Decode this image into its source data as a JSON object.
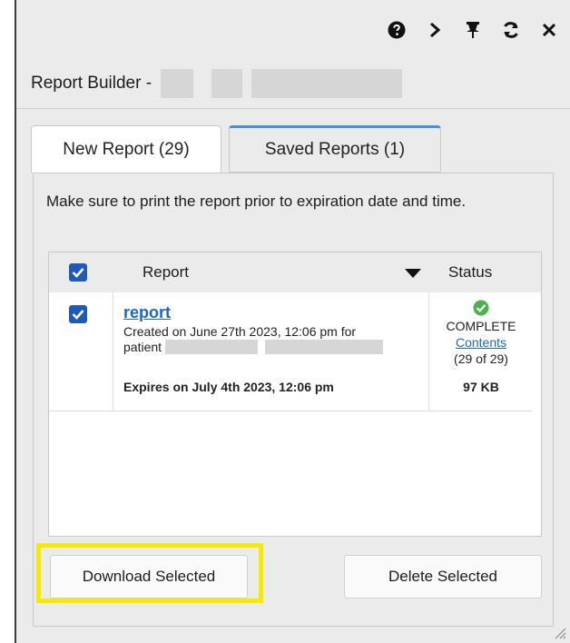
{
  "header": {
    "title": "Report Builder -",
    "icons": [
      "help-icon",
      "collapse-icon",
      "pin-icon",
      "refresh-icon",
      "close-icon"
    ]
  },
  "tabs": [
    {
      "label": "New Report (29)"
    },
    {
      "label": "Saved Reports (1)"
    }
  ],
  "notice": "Make sure to print the report prior to expiration date and time.",
  "table": {
    "columns": {
      "report": "Report",
      "status": "Status"
    },
    "rows": [
      {
        "name": "report",
        "created": "Created on June 27th 2023, 12:06 pm for",
        "patient_label": "patient",
        "expires": "Expires on July 4th 2023, 12:06 pm",
        "status": "COMPLETE",
        "contents_link": "Contents",
        "count": "(29 of 29)",
        "size": "97 KB"
      }
    ]
  },
  "buttons": {
    "download": "Download Selected",
    "delete": "Delete Selected"
  },
  "colors": {
    "accent": "#1e5ab6",
    "link": "#1a66c9",
    "highlight": "#f5ea05",
    "tab_active_border": "#4a90d9",
    "complete": "#4caf50"
  }
}
